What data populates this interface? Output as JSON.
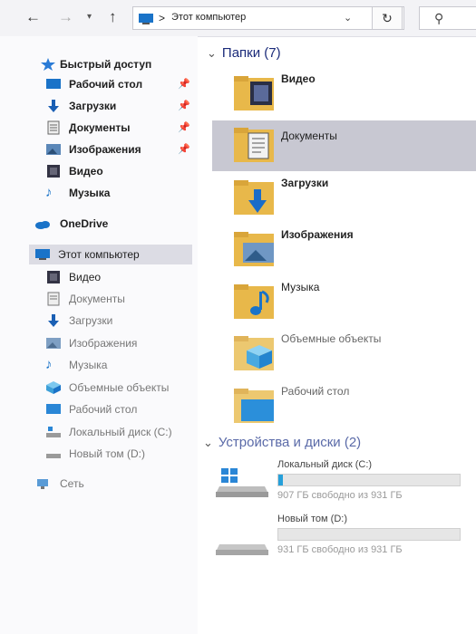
{
  "window": {
    "breadcrumb_sep": ">",
    "path": "Этот компьютер",
    "icons": {
      "back": "arrow-left",
      "forward": "arrow-right",
      "recent": "chevron-down",
      "up": "arrow-up",
      "refresh": "refresh",
      "search": "magnifier"
    }
  },
  "sidebar": {
    "quick_access": "Быстрый доступ",
    "quick_items": [
      {
        "label": "Рабочий стол",
        "icon": "desktop-icon",
        "pinned": true
      },
      {
        "label": "Загрузки",
        "icon": "downloads-icon",
        "pinned": true
      },
      {
        "label": "Документы",
        "icon": "documents-icon",
        "pinned": true
      },
      {
        "label": "Изображения",
        "icon": "images-icon",
        "pinned": true
      },
      {
        "label": "Видео",
        "icon": "video-icon",
        "pinned": false
      },
      {
        "label": "Музыка",
        "icon": "music-icon",
        "pinned": false
      }
    ],
    "onedrive": "OneDrive",
    "this_pc": "Этот компьютер",
    "pc_items": [
      {
        "label": "Видео",
        "icon": "video-icon"
      },
      {
        "label": "Документы",
        "icon": "documents-icon"
      },
      {
        "label": "Загрузки",
        "icon": "downloads-icon"
      },
      {
        "label": "Изображения",
        "icon": "images-icon"
      },
      {
        "label": "Музыка",
        "icon": "music-icon"
      },
      {
        "label": "Объемные объекты",
        "icon": "3d-objects-icon"
      },
      {
        "label": "Рабочий стол",
        "icon": "desktop-icon"
      },
      {
        "label": "Локальный диск (C:)",
        "icon": "drive-icon"
      },
      {
        "label": "Новый том (D:)",
        "icon": "drive-icon"
      }
    ],
    "network": "Сеть"
  },
  "main": {
    "folders_header": "Папки (7)",
    "folders": [
      {
        "name": "Видео",
        "icon": "video-folder-icon",
        "selected": false
      },
      {
        "name": "Документы",
        "icon": "documents-folder-icon",
        "selected": true
      },
      {
        "name": "Загрузки",
        "icon": "downloads-folder-icon",
        "selected": false
      },
      {
        "name": "Изображения",
        "icon": "images-folder-icon",
        "selected": false
      },
      {
        "name": "Музыка",
        "icon": "music-folder-icon",
        "selected": false
      },
      {
        "name": "Объемные объекты",
        "icon": "3d-objects-folder-icon",
        "selected": false
      },
      {
        "name": "Рабочий стол",
        "icon": "desktop-folder-icon",
        "selected": false
      }
    ],
    "drives_header": "Устройства и диски (2)",
    "drives": [
      {
        "name": "Локальный диск (C:)",
        "free": "907 ГБ свободно из 931 ГБ",
        "used_fraction": 0.026,
        "icon": "windows-drive-icon"
      },
      {
        "name": "Новый том (D:)",
        "free": "931 ГБ свободно из 931 ГБ",
        "used_fraction": 0.0,
        "icon": "drive-icon"
      }
    ]
  },
  "colors": {
    "accent": "#26a0da",
    "folder": "#e8b84a",
    "selection": "#c8c8d2",
    "header_text": "#1b2b7a"
  }
}
